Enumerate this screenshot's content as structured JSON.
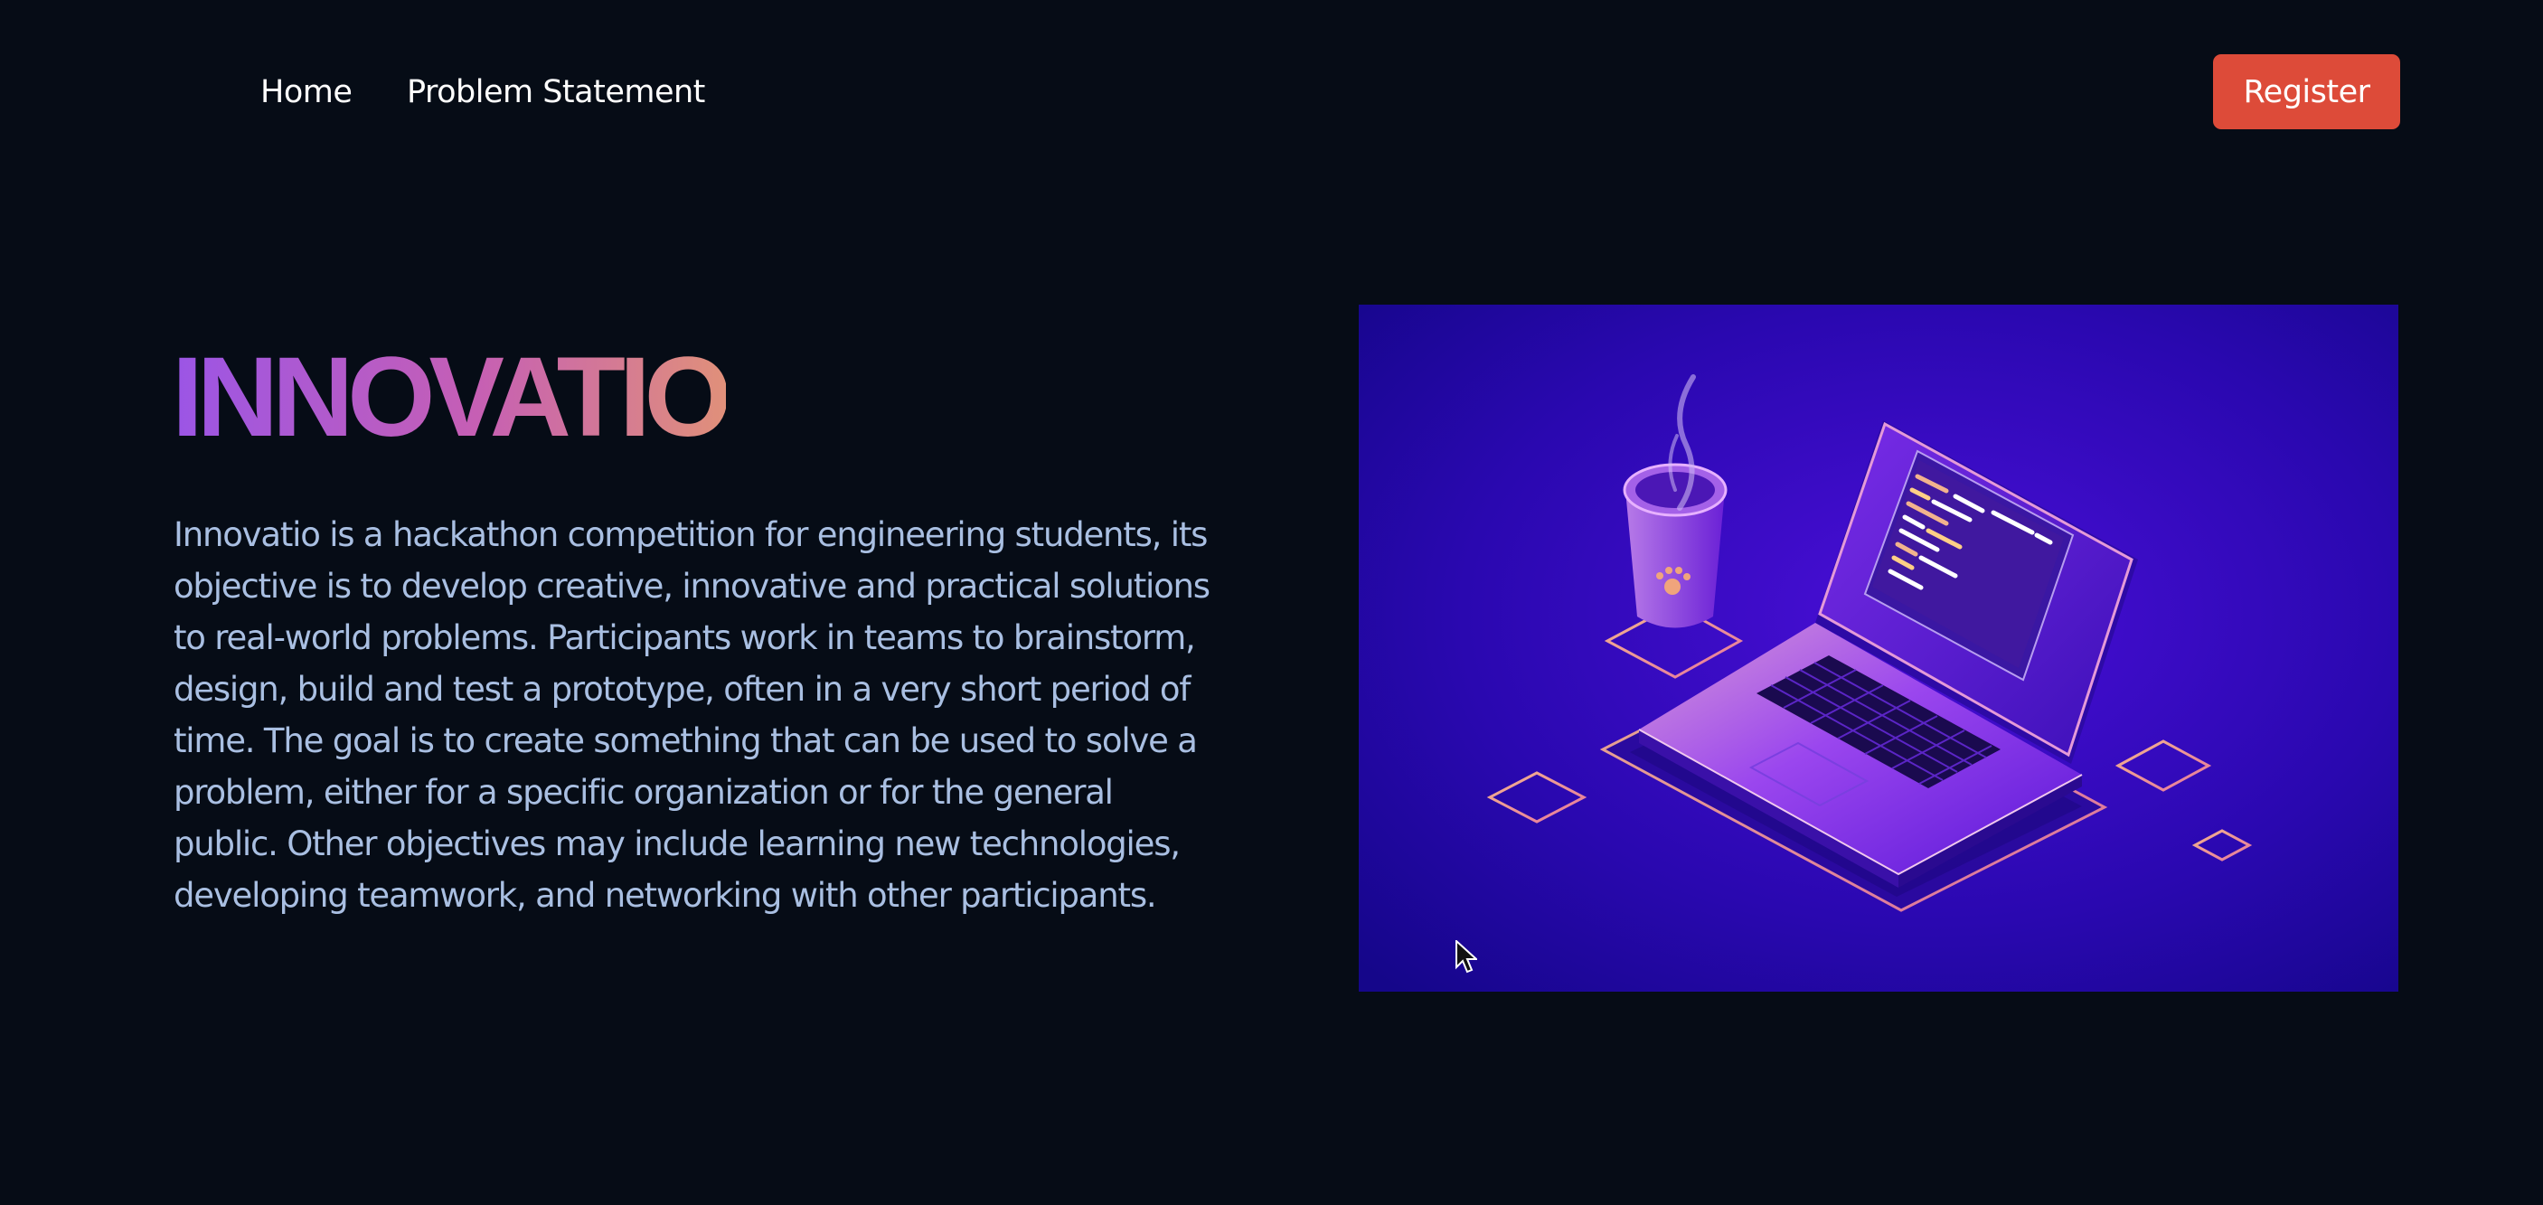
{
  "nav": {
    "home_label": "Home",
    "problem_label": "Problem Statement",
    "register_label": "Register"
  },
  "hero": {
    "title": "INNOVATIO",
    "description": "Innovatio is a hackathon competition for engineering students, its objective is to develop creative, innovative and practical solutions to real-world problems. Participants work in teams to brainstorm, design, build and test a prototype, often in a very short period of time. The goal is to create something that can be used to solve a problem, either for a specific organization or for the general public. Other objectives may include learning new technologies, developing teamwork, and networking with other participants.",
    "illustration_icon": "laptop-coffee-isometric-illustration"
  },
  "colors": {
    "background": "#060c16",
    "register_button": "#dd4b39",
    "description_text": "#a9bfe2",
    "title_gradient_start": "#9b55e6",
    "title_gradient_end": "#e0907a",
    "illustration_background": "#2a06b3"
  }
}
